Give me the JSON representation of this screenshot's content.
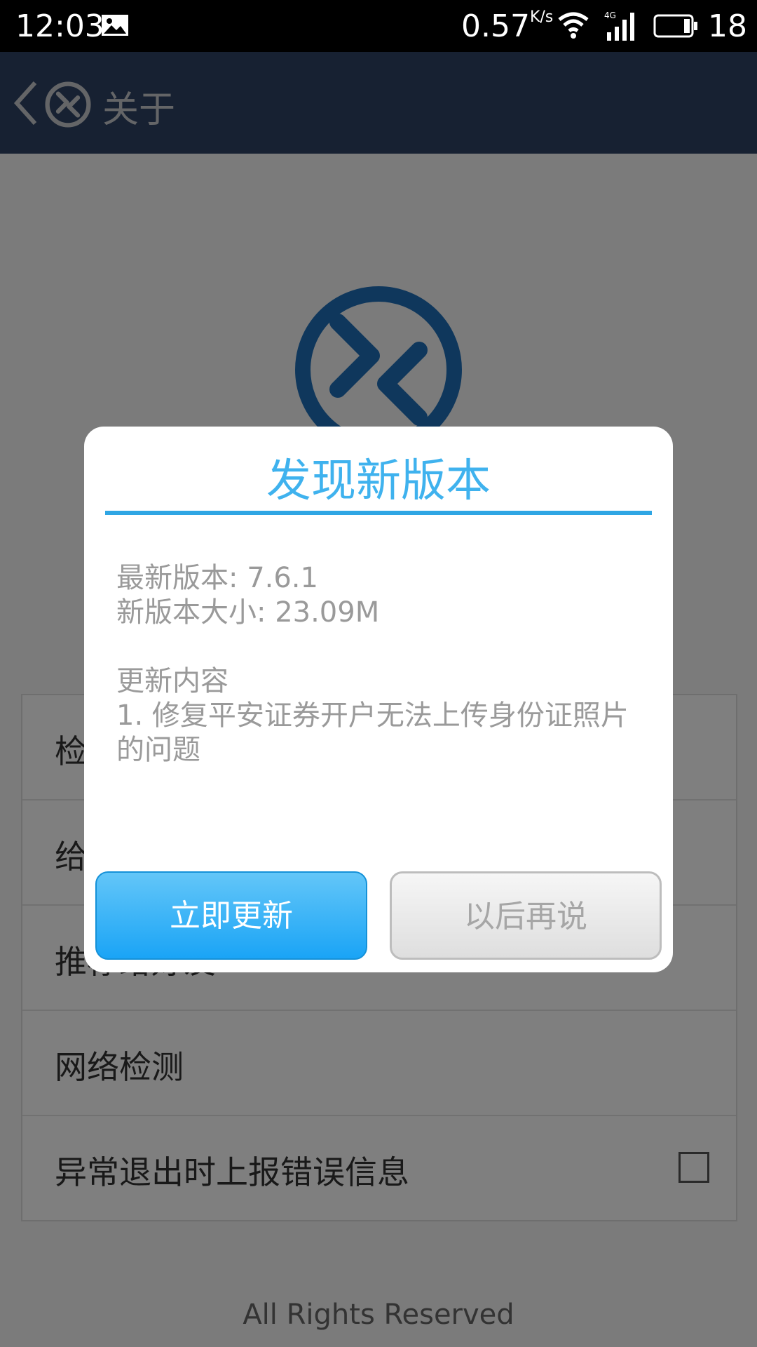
{
  "status_bar": {
    "time": "12:03",
    "speed": "0.57",
    "speed_unit": "K/s",
    "battery": "18",
    "icons": [
      "image-icon",
      "wifi-icon",
      "4g-signal-icon",
      "battery-icon"
    ]
  },
  "app_bar": {
    "title": "关于",
    "color": "#2f4364"
  },
  "settings_list": {
    "items": [
      {
        "label": "检查更新"
      },
      {
        "label": "给我们评分"
      },
      {
        "label": "推荐给好友"
      },
      {
        "label": "网络检测"
      },
      {
        "label": "异常退出时上报错误信息",
        "checkbox": false
      }
    ]
  },
  "footer": {
    "text": "All Rights Reserved"
  },
  "dialog": {
    "title": "发现新版本",
    "latest_version": "最新版本: 7.6.1",
    "new_size": "新版本大小: 23.09M",
    "content_heading": "更新内容",
    "content_item": "1. 修复平安证券开户无法上传身份证照片的问题",
    "update_button": "立即更新",
    "later_button": "以后再说",
    "accent_color": "#3fb2ee"
  }
}
